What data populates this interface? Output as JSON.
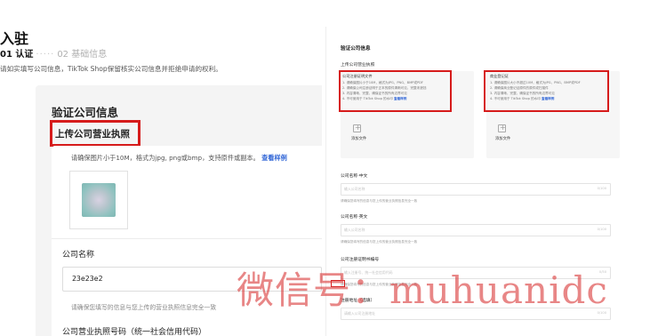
{
  "left": {
    "title": "入驻",
    "steps": {
      "active": "01 认证",
      "dots": "·····",
      "next": "02 基础信息"
    },
    "hint": "请如实填写公司信息，TikTok Shop保留核实公司信息并拒绝申请的权利。",
    "section_title": "验证公司信息",
    "upload_label": "上传公司营业执照",
    "upload_req": "请确保图片小于10M，格式为jpg, png或bmp，支持原件或副本。",
    "upload_req_link": "查看样例",
    "company_name_label": "公司名称",
    "company_name_value": "23e23e2",
    "company_name_hint": "请确保您填写的信息与您上传的营业执照信息完全一致",
    "license_code_label": "公司营业执照号码（统一社会信用代码）"
  },
  "right": {
    "title": "验证公司信息",
    "upload_section_label": "上传公司营业执照",
    "upload_a": {
      "title": "公司注册证明文件",
      "lines": [
        "1. 请确保图片小于10M，格式为JPG、PNG、BMP或PDF",
        "2. 请确保公司注册证明于正本的原件清晰可见，完整未遮挡",
        "3. 内容清晰、完整、确保证书的所有边界可见",
        "4. 不可使用于 TikTok Shop 的水印"
      ],
      "link": "查看样例",
      "add_text": "添加文件"
    },
    "upload_b": {
      "title": "商业登记证",
      "lines": [
        "1. 请确保图片大小不超过10M，格式为JPG、PNG、BMP或PDF",
        "2. 请确保商业登记证原件的原件或扫描件",
        "3. 内容清晰、完整、确保证书的所有边界可见",
        "4. 不可使用于 TikTok Shop 的水印"
      ],
      "link": "查看样例",
      "add_text": "添加文件"
    },
    "fields": [
      {
        "label": "公司名称·中文",
        "placeholder": "输入公司名称",
        "count": "0/100",
        "hint": "请确保您填写的信息与您上传的营业执照信息完全一致"
      },
      {
        "label": "公司名称·英文",
        "placeholder": "输入公司名称",
        "count": "0/100",
        "hint": "请确保您填写的信息与您上传的营业执照信息完全一致"
      },
      {
        "label": "公司注册证明书编号",
        "placeholder": "输入注册号、统一社会信用代码",
        "count": "0/50",
        "hint": "请确保您填写的信息与您上传的营业执照信息完全一致"
      },
      {
        "label": "注册地址（选填）",
        "placeholder": "请输入公司注册地址",
        "count": "0/100",
        "hint": ""
      }
    ]
  },
  "watermark": "微信号：muhuanidc"
}
